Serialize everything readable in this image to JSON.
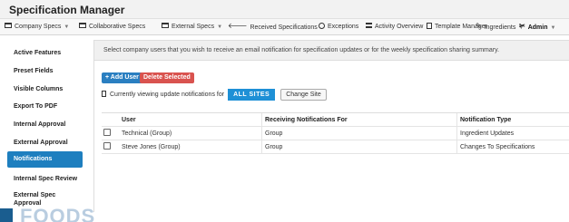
{
  "app": {
    "title": "Specification Manager"
  },
  "nav": {
    "items": [
      {
        "label": "Company Specs",
        "icon": "cabinet-icon",
        "has_dropdown": true
      },
      {
        "label": "Collaborative Specs",
        "icon": "cabinet-icon",
        "has_dropdown": false
      },
      {
        "label": "External Specs",
        "icon": "cabinet-icon",
        "has_dropdown": true
      },
      {
        "label": "Received Specifications",
        "icon": "arrow-left-icon",
        "has_dropdown": false
      },
      {
        "label": "Exceptions",
        "icon": "check-circle-icon",
        "has_dropdown": false
      },
      {
        "label": "Activity Overview",
        "icon": "list-icon",
        "has_dropdown": false
      },
      {
        "label": "Template Manager",
        "icon": "document-icon",
        "has_dropdown": false
      },
      {
        "label": "Ingredients",
        "icon": "leaf-icon",
        "has_dropdown": true
      },
      {
        "label": "Admin",
        "icon": "wrench-icon",
        "has_dropdown": true,
        "active": true
      }
    ]
  },
  "sidebar": {
    "items": [
      {
        "label": "Active Features"
      },
      {
        "label": "Preset Fields"
      },
      {
        "label": "Visible Columns"
      },
      {
        "label": "Export To PDF"
      },
      {
        "label": "Internal Approval"
      },
      {
        "label": "External Approval"
      },
      {
        "label": "Notifications",
        "active": true
      },
      {
        "label": "Internal Spec Review"
      },
      {
        "label": "External Spec Approval"
      }
    ]
  },
  "main": {
    "info_text": "Select company users that you wish to receive an email notification for specification updates or for the weekly specification sharing summary.",
    "add_user_label": "+ Add User",
    "delete_selected_label": "Delete Selected",
    "site_text": "Currently viewing update notifications for",
    "site_badge": "ALL SITES",
    "change_site_label": "Change Site",
    "table": {
      "headers": [
        "User",
        "Receiving Notifications For",
        "Notification Type"
      ],
      "rows": [
        {
          "user": "Technical (Group)",
          "receiving": "Group",
          "type": "Ingredient Updates",
          "checked": false
        },
        {
          "user": "Steve Jones (Group)",
          "receiving": "Group",
          "type": "Changes To Specifications",
          "checked": false
        }
      ]
    }
  },
  "footer": {
    "logo_text": "FOODS"
  },
  "colors": {
    "accent": "#1e7fbf",
    "add_button": "#2a7fc1",
    "delete_button": "#d9534f",
    "badge": "#1e90d6"
  }
}
